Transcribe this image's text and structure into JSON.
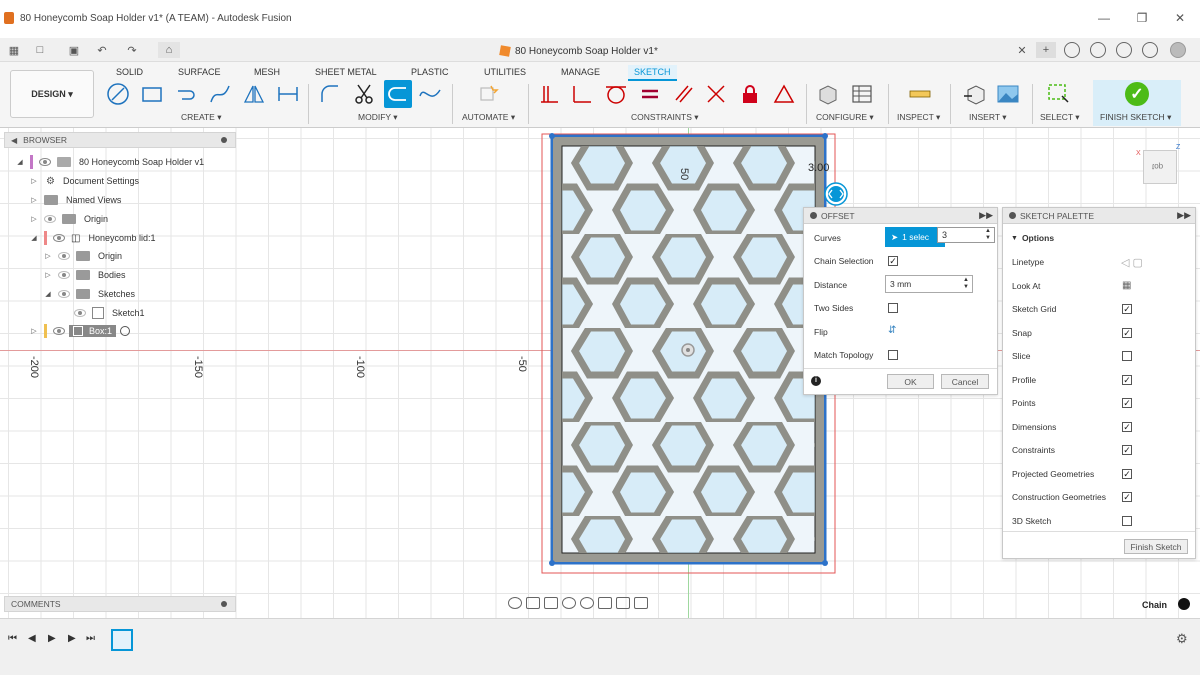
{
  "window": {
    "title": "80 Honeycomb Soap Holder v1* (A TEAM) - Autodesk Fusion",
    "doc_tab": "80 Honeycomb Soap Holder v1*"
  },
  "ribbon": {
    "design_label": "DESIGN",
    "tabs": [
      "SOLID",
      "SURFACE",
      "MESH",
      "SHEET METAL",
      "PLASTIC",
      "UTILITIES",
      "MANAGE",
      "SKETCH"
    ],
    "active_tab": "SKETCH",
    "groups": [
      "CREATE",
      "MODIFY",
      "AUTOMATE",
      "CONSTRAINTS",
      "CONFIGURE",
      "INSPECT",
      "INSERT",
      "SELECT",
      "FINISH SKETCH"
    ],
    "accent_color": "#0696d7"
  },
  "browser": {
    "header": "BROWSER",
    "items": [
      {
        "label": "80 Honeycomb Soap Holder v1"
      },
      {
        "label": "Document Settings"
      },
      {
        "label": "Named Views"
      },
      {
        "label": "Origin"
      },
      {
        "label": "Honeycomb lid:1"
      },
      {
        "label": "Origin"
      },
      {
        "label": "Bodies"
      },
      {
        "label": "Sketches"
      },
      {
        "label": "Sketch1"
      },
      {
        "label": "Box:1"
      }
    ]
  },
  "comments": {
    "header": "COMMENTS"
  },
  "axis": {
    "labels": [
      "-200",
      "-150",
      "-100",
      "-50"
    ],
    "dimension": "50",
    "offset_value": "3.00"
  },
  "offset_dialog": {
    "title": "OFFSET",
    "curves_label": "Curves",
    "curves_value": "1 selec",
    "typed_value": "3",
    "chain_label": "Chain Selection",
    "chain_checked": true,
    "distance_label": "Distance",
    "distance_value": "3 mm",
    "two_sides_label": "Two Sides",
    "flip_label": "Flip",
    "match_label": "Match Topology",
    "ok_label": "OK",
    "cancel_label": "Cancel"
  },
  "sketch_palette": {
    "title": "SKETCH PALETTE",
    "section": "Options",
    "options": [
      {
        "label": "Linetype",
        "kind": "icons"
      },
      {
        "label": "Look At",
        "kind": "icon"
      },
      {
        "label": "Sketch Grid",
        "checked": true
      },
      {
        "label": "Snap",
        "checked": true
      },
      {
        "label": "Slice",
        "checked": false
      },
      {
        "label": "Profile",
        "checked": true
      },
      {
        "label": "Points",
        "checked": true
      },
      {
        "label": "Dimensions",
        "checked": true
      },
      {
        "label": "Constraints",
        "checked": true
      },
      {
        "label": "Projected Geometries",
        "checked": true
      },
      {
        "label": "Construction Geometries",
        "checked": true
      },
      {
        "label": "3D Sketch",
        "checked": false
      }
    ],
    "finish_label": "Finish Sketch"
  },
  "viewcube": {
    "label": "top"
  },
  "status": {
    "chain": "Chain"
  }
}
